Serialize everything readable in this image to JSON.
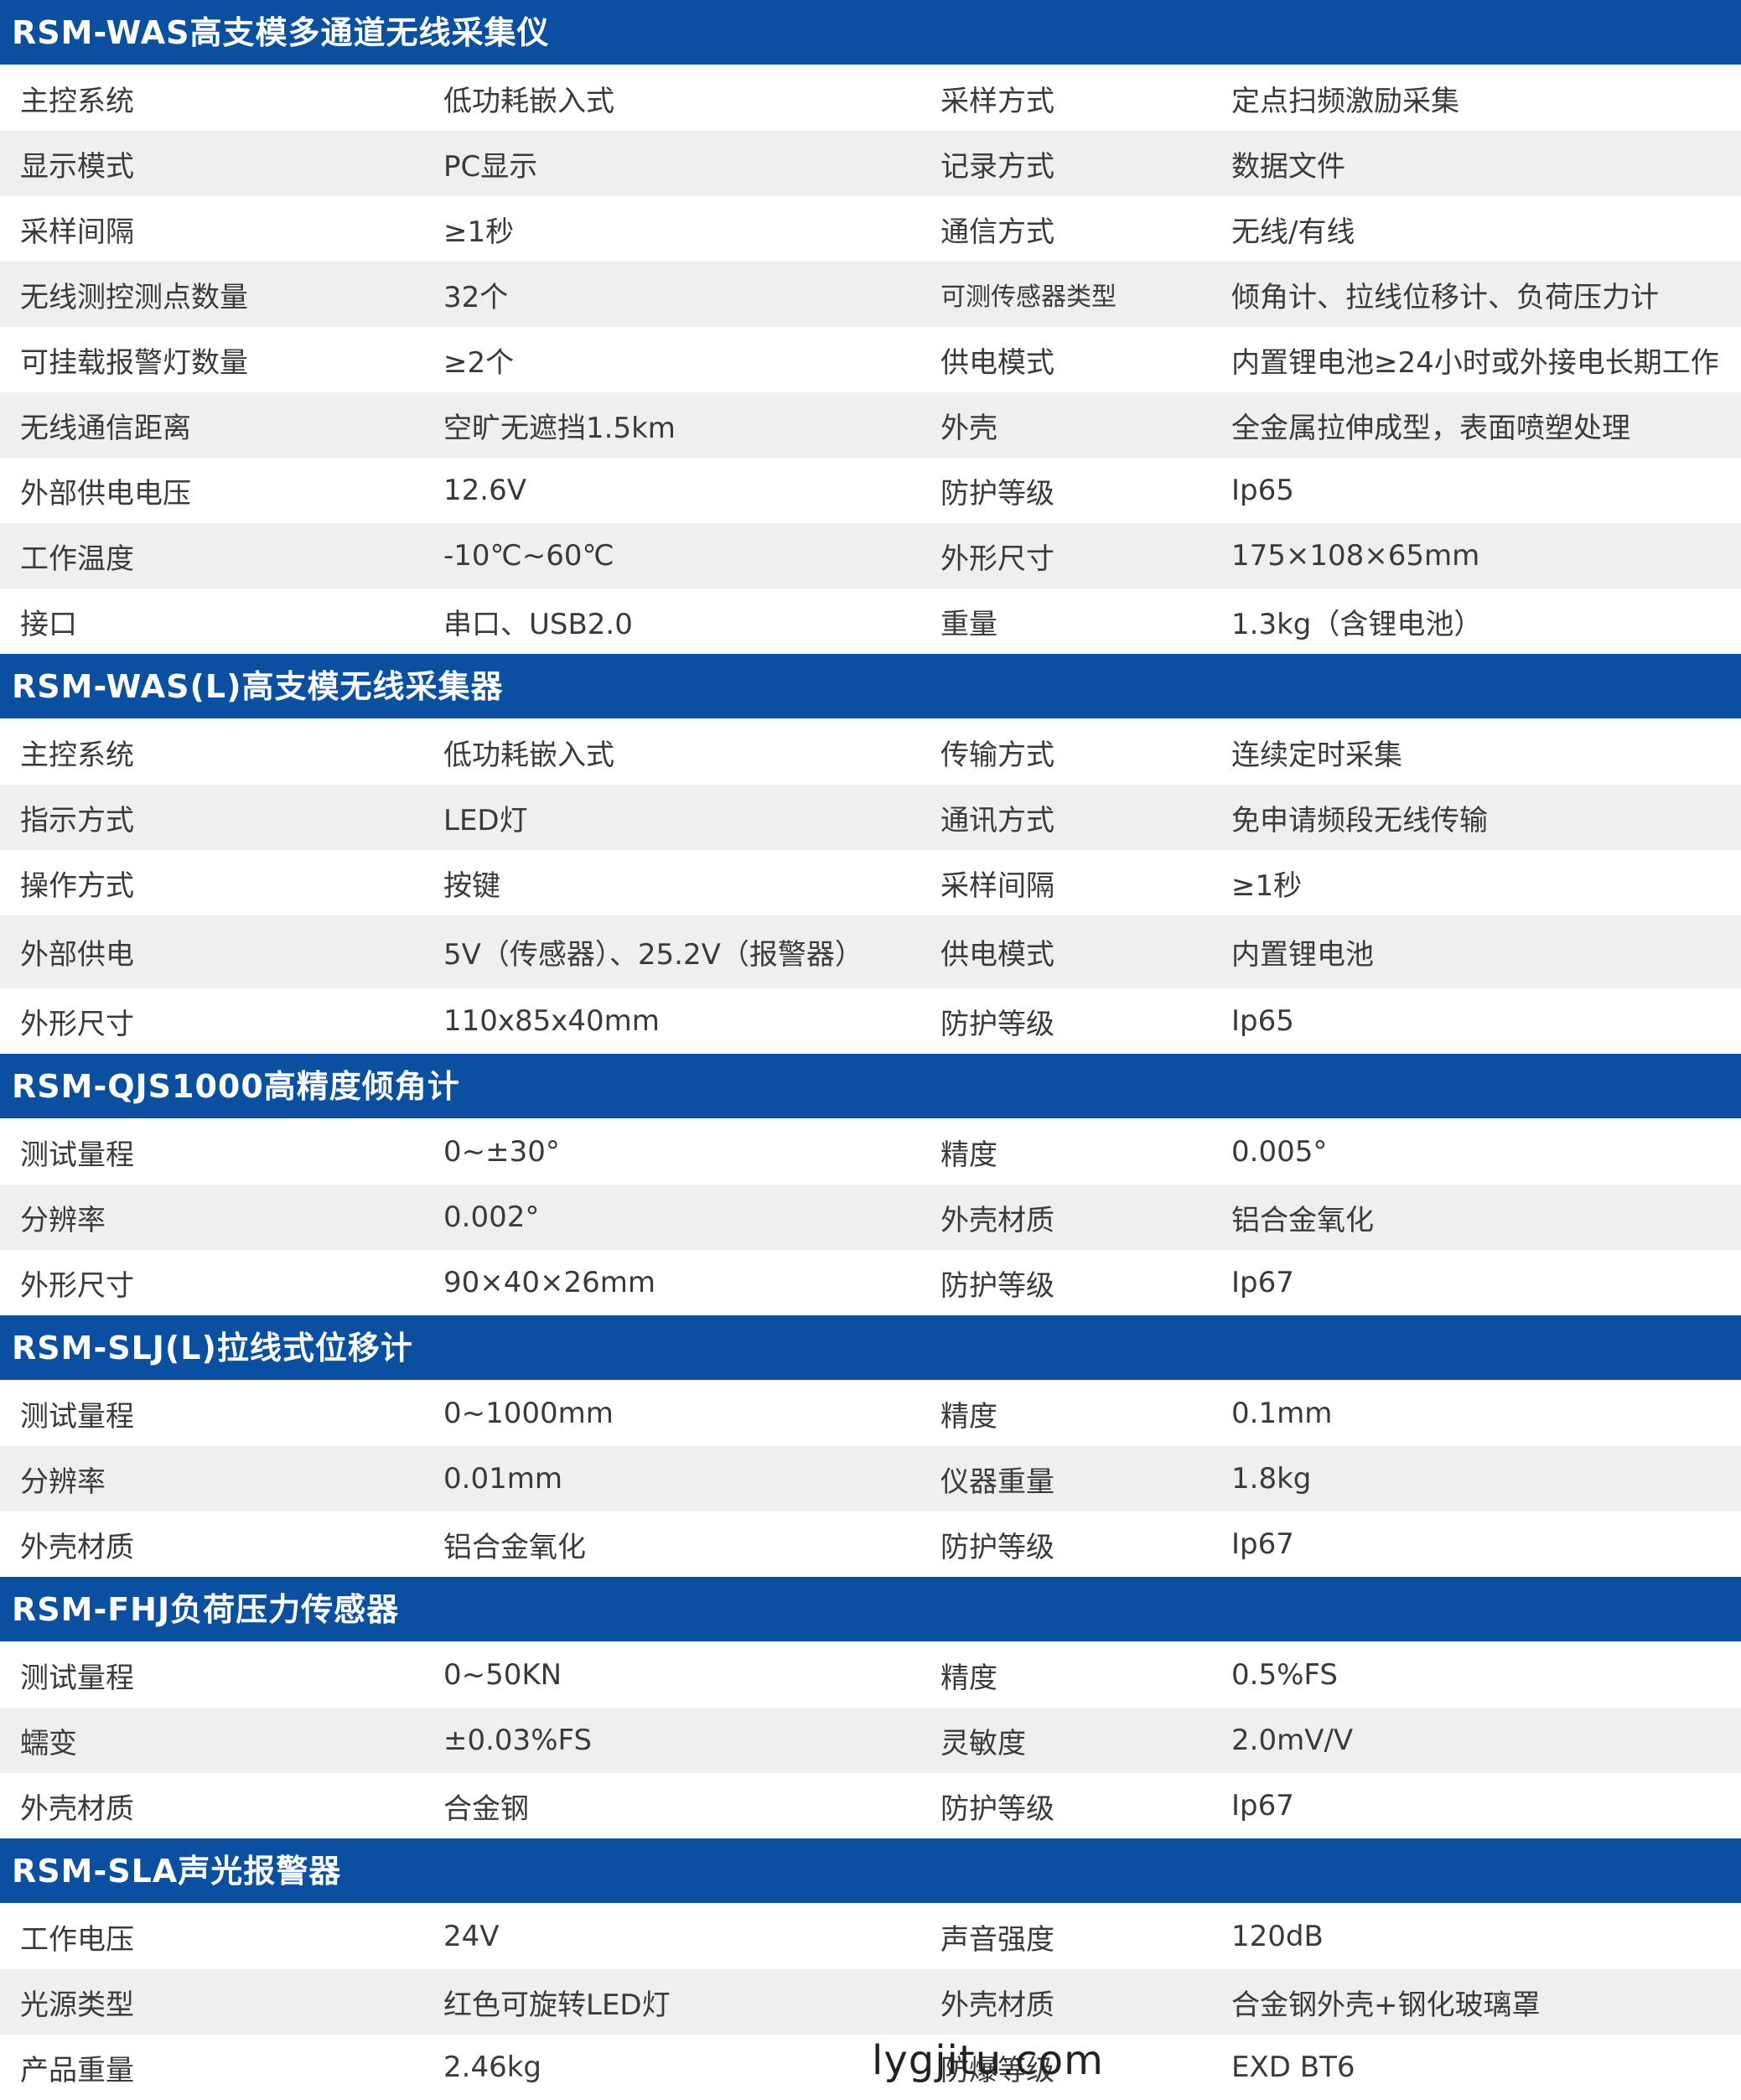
{
  "sections": [
    {
      "title": "RSM-WAS高支模多通道无线采集仪",
      "rows": [
        [
          "主控系统",
          "低功耗嵌入式",
          "采样方式",
          "定点扫频激励采集"
        ],
        [
          "显示模式",
          "PC显示",
          "记录方式",
          "数据文件"
        ],
        [
          "采样间隔",
          "≥1秒",
          "通信方式",
          "无线/有线"
        ],
        [
          "无线测控测点数量",
          "32个",
          "可测传感器类型",
          "倾角计、拉线位移计、负荷压力计"
        ],
        [
          "可挂载报警灯数量",
          "≥2个",
          "供电模式",
          "内置锂电池≥24小时或外接电长期工作"
        ],
        [
          "无线通信距离",
          "空旷无遮挡1.5km",
          "外壳",
          "全金属拉伸成型，表面喷塑处理"
        ],
        [
          "外部供电电压",
          "12.6V",
          "防护等级",
          "Ip65"
        ],
        [
          "工作温度",
          "-10℃~60℃",
          "外形尺寸",
          "175×108×65mm"
        ],
        [
          "接口",
          "串口、USB2.0",
          "重量",
          "1.3kg（含锂电池）"
        ]
      ]
    },
    {
      "title": "RSM-WAS(L)高支模无线采集器",
      "rows": [
        [
          "主控系统",
          "低功耗嵌入式",
          "传输方式",
          "连续定时采集"
        ],
        [
          "指示方式",
          "LED灯",
          "通讯方式",
          "免申请频段无线传输"
        ],
        [
          "操作方式",
          "按键",
          "采样间隔",
          "≥1秒"
        ],
        [
          "外部供电",
          "5V（传感器）、25.2V（报警器）",
          "供电模式",
          "内置锂电池"
        ],
        [
          "外形尺寸",
          "110x85x40mm",
          "防护等级",
          "Ip65"
        ]
      ]
    },
    {
      "title": "RSM-QJS1000高精度倾角计",
      "rows": [
        [
          "测试量程",
          "0~±30°",
          "精度",
          "0.005°"
        ],
        [
          "分辨率",
          "0.002°",
          "外壳材质",
          "铝合金氧化"
        ],
        [
          "外形尺寸",
          "90×40×26mm",
          "防护等级",
          "Ip67"
        ]
      ]
    },
    {
      "title": "RSM-SLJ(L)拉线式位移计",
      "rows": [
        [
          "测试量程",
          "0~1000mm",
          "精度",
          "0.1mm"
        ],
        [
          "分辨率",
          "0.01mm",
          "仪器重量",
          "1.8kg"
        ],
        [
          "外壳材质",
          "铝合金氧化",
          "防护等级",
          "Ip67"
        ]
      ]
    },
    {
      "title": "RSM-FHJ负荷压力传感器",
      "rows": [
        [
          "测试量程",
          "0~50KN",
          "精度",
          "0.5%FS"
        ],
        [
          "蠕变",
          "±0.03%FS",
          "灵敏度",
          "2.0mV/V"
        ],
        [
          "外壳材质",
          "合金钢",
          "防护等级",
          "Ip67"
        ]
      ]
    },
    {
      "title": "RSM-SLA声光报警器",
      "rows": [
        [
          "工作电压",
          "24V",
          "声音强度",
          "120dB"
        ],
        [
          "光源类型",
          "红色可旋转LED灯",
          "外壳材质",
          "合金钢外壳+钢化玻璃罩"
        ],
        [
          "产品重量",
          "2.46kg",
          "防爆等级",
          "EXD BT6"
        ]
      ]
    }
  ],
  "watermark": "lygjitu.com",
  "colors": {
    "header_bg": "#0a4fa0",
    "row_shade": "#efefef",
    "text": "#3a3a3a"
  }
}
